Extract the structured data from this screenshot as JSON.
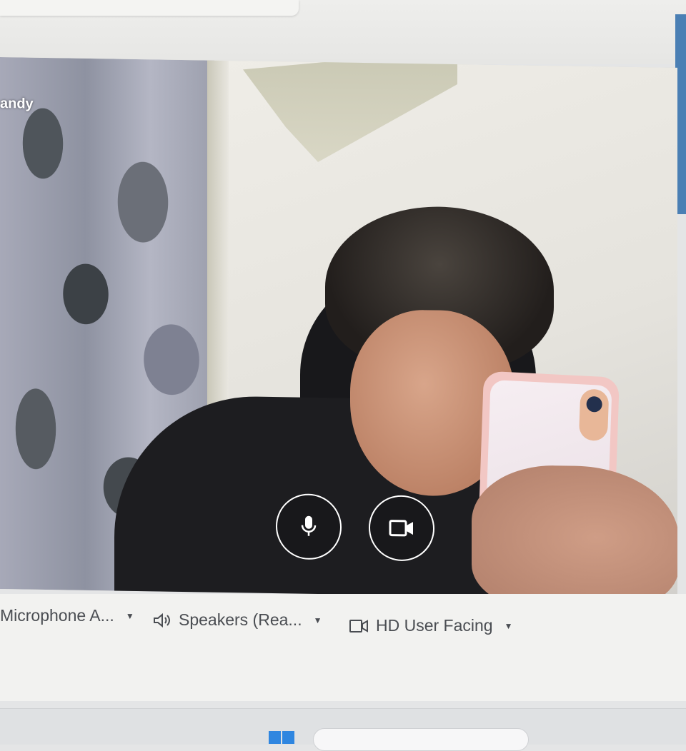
{
  "call": {
    "participant_name": "andy"
  },
  "controls": {
    "mic_icon": "microphone-icon",
    "camera_icon": "video-camera-icon"
  },
  "devices": {
    "microphone": {
      "label": "Microphone A...",
      "icon": "microphone-icon"
    },
    "speakers": {
      "label": "Speakers (Rea...",
      "icon": "speaker-icon"
    },
    "camera": {
      "label": "HD User Facing",
      "icon": "video-camera-icon"
    }
  },
  "colors": {
    "control_ring": "#ffffff",
    "device_text": "#4a4d52",
    "taskbar_start": "#2f86e0"
  }
}
